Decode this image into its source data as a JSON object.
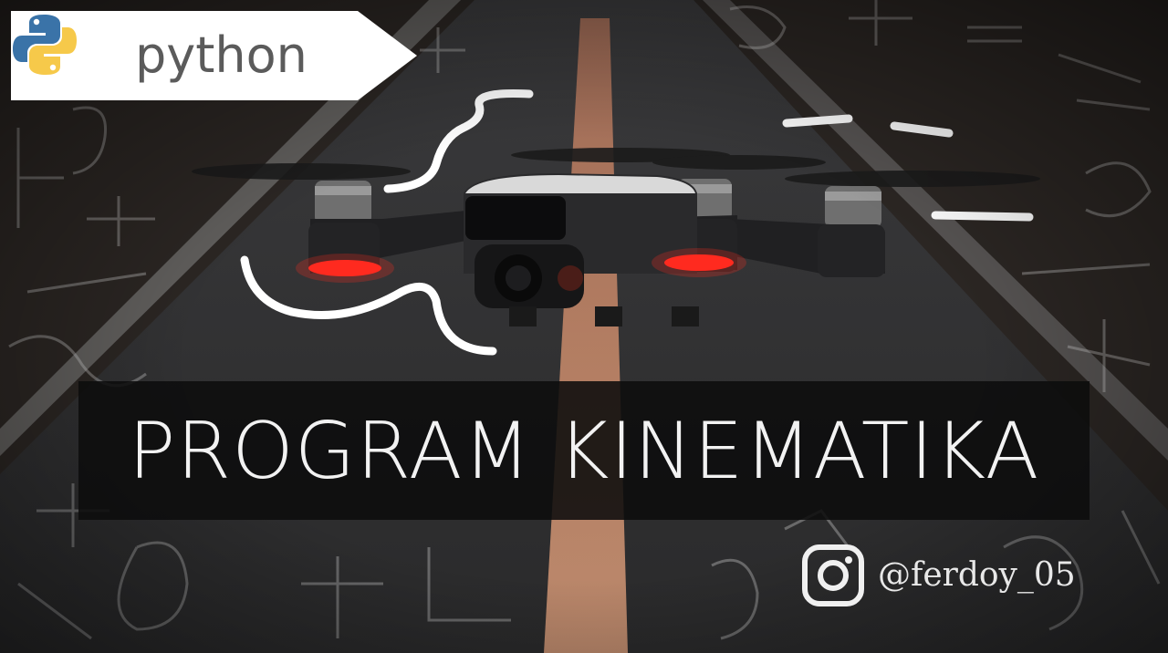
{
  "badge": {
    "label": "python",
    "icon": "python-logo-icon",
    "colors": {
      "blue": "#3a73a8",
      "yellow": "#f6c94a",
      "text": "#5b5b5b"
    }
  },
  "title": "PROGRAM KINEMATIKA",
  "social": {
    "icon": "instagram-icon",
    "handle": "@ferdoy_05"
  },
  "hero": {
    "subject": "drone-icon",
    "led_color": "#ff2a1f"
  }
}
